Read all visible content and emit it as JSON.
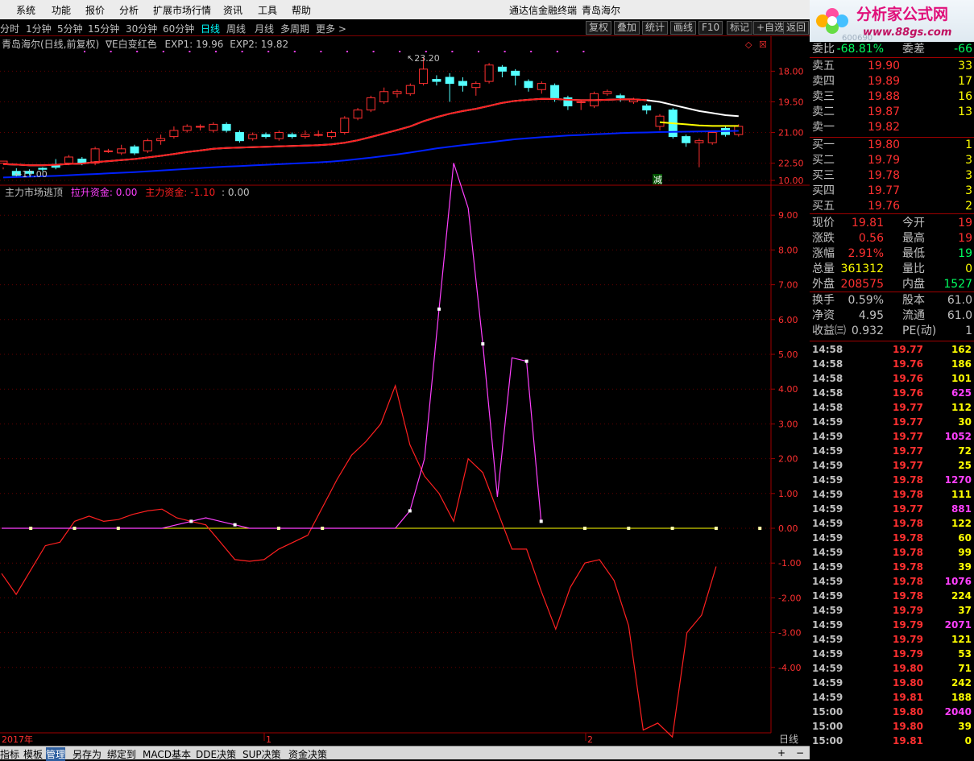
{
  "menu": [
    "系统",
    "功能",
    "报价",
    "分析",
    "扩展市场行情",
    "资讯",
    "工具",
    "帮助"
  ],
  "app_title": "通达信金融终端",
  "stock_name": "青岛海尔",
  "periods": [
    "分时",
    "1分钟",
    "5分钟",
    "15分钟",
    "30分钟",
    "60分钟",
    "日线",
    "周线",
    "月线",
    "多周期",
    "更多"
  ],
  "active_period": "日线",
  "tools": [
    "复权",
    "叠加",
    "统计",
    "画线",
    "F10",
    "标记",
    "+自选",
    "返回"
  ],
  "logo": {
    "brand": "分析家公式网",
    "url": "www.88gs.com",
    "code_hint": "600690"
  },
  "price_chart": {
    "title": "青岛海尔(日线,前复权)",
    "indicator": "∇E白变红色",
    "exp1_label": "EXP1:",
    "exp1_value": "19.96",
    "exp2_label": "EXP2:",
    "exp2_value": "19.82",
    "high_label": "23.20",
    "low_label": "17.00",
    "signal_text": "减",
    "y_ticks": [
      "22.50",
      "21.00",
      "19.50",
      "18.00"
    ]
  },
  "indicator_chart": {
    "title": "主力市场逃顶",
    "s1_label": "拉升资金:",
    "s1_value": "0.00",
    "s2_label": "主力资金:",
    "s2_value": "-1.10",
    "s3_value": ": 0.00",
    "y_ticks": [
      "10.00",
      "9.00",
      "8.00",
      "7.00",
      "6.00",
      "5.00",
      "4.00",
      "3.00",
      "2.00",
      "1.00",
      "0.00",
      "-1.00",
      "-2.00",
      "-3.00",
      "-4.00"
    ]
  },
  "x_axis": {
    "labels": [
      "2017年",
      "1",
      "2"
    ],
    "period": "日线"
  },
  "quote": {
    "wb_label": "委比",
    "wb_value": "-68.81%",
    "wc_label": "委差",
    "wc_value": "-66",
    "asks": [
      {
        "label": "卖五",
        "price": "19.90",
        "vol": "33"
      },
      {
        "label": "卖四",
        "price": "19.89",
        "vol": "17"
      },
      {
        "label": "卖三",
        "price": "19.88",
        "vol": "16"
      },
      {
        "label": "卖二",
        "price": "19.87",
        "vol": "13"
      },
      {
        "label": "卖一",
        "price": "19.82",
        "vol": ""
      }
    ],
    "bids": [
      {
        "label": "买一",
        "price": "19.80",
        "vol": "1"
      },
      {
        "label": "买二",
        "price": "19.79",
        "vol": "3"
      },
      {
        "label": "买三",
        "price": "19.78",
        "vol": "3"
      },
      {
        "label": "买四",
        "price": "19.77",
        "vol": "3"
      },
      {
        "label": "买五",
        "price": "19.76",
        "vol": "2"
      }
    ],
    "stats": [
      {
        "l1": "现价",
        "v1": "19.81",
        "l2": "今开",
        "v2": "19"
      },
      {
        "l1": "涨跌",
        "v1": "0.56",
        "l2": "最高",
        "v2": "19"
      },
      {
        "l1": "涨幅",
        "v1": "2.91%",
        "l2": "最低",
        "v2": "19"
      },
      {
        "l1": "总量",
        "v1": "361312",
        "l2": "量比",
        "v2": "0"
      },
      {
        "l1": "外盘",
        "v1": "208575",
        "l2": "内盘",
        "v2": "1527"
      }
    ],
    "stats2": [
      {
        "l1": "换手",
        "v1": "0.59%",
        "l2": "股本",
        "v2": "61.0"
      },
      {
        "l1": "净资",
        "v1": "4.95",
        "l2": "流通",
        "v2": "61.0"
      },
      {
        "l1": "收益㈢",
        "v1": "0.932",
        "l2": "PE(动)",
        "v2": "1"
      }
    ]
  },
  "ticks": [
    {
      "t": "14:58",
      "p": "19.77",
      "v": "162",
      "c": "w"
    },
    {
      "t": "14:58",
      "p": "19.76",
      "v": "186",
      "c": "w"
    },
    {
      "t": "14:58",
      "p": "19.76",
      "v": "101",
      "c": "w"
    },
    {
      "t": "14:58",
      "p": "19.76",
      "v": "625",
      "c": "m"
    },
    {
      "t": "14:58",
      "p": "19.77",
      "v": "112",
      "c": "w"
    },
    {
      "t": "14:59",
      "p": "19.77",
      "v": "30",
      "c": "w"
    },
    {
      "t": "14:59",
      "p": "19.77",
      "v": "1052",
      "c": "m"
    },
    {
      "t": "14:59",
      "p": "19.77",
      "v": "72",
      "c": "w"
    },
    {
      "t": "14:59",
      "p": "19.77",
      "v": "25",
      "c": "w"
    },
    {
      "t": "14:59",
      "p": "19.78",
      "v": "1270",
      "c": "m"
    },
    {
      "t": "14:59",
      "p": "19.78",
      "v": "111",
      "c": "w"
    },
    {
      "t": "14:59",
      "p": "19.77",
      "v": "881",
      "c": "m"
    },
    {
      "t": "14:59",
      "p": "19.78",
      "v": "122",
      "c": "w"
    },
    {
      "t": "14:59",
      "p": "19.78",
      "v": "60",
      "c": "w"
    },
    {
      "t": "14:59",
      "p": "19.78",
      "v": "99",
      "c": "w"
    },
    {
      "t": "14:59",
      "p": "19.78",
      "v": "39",
      "c": "w"
    },
    {
      "t": "14:59",
      "p": "19.78",
      "v": "1076",
      "c": "m"
    },
    {
      "t": "14:59",
      "p": "19.78",
      "v": "224",
      "c": "w"
    },
    {
      "t": "14:59",
      "p": "19.79",
      "v": "37",
      "c": "w"
    },
    {
      "t": "14:59",
      "p": "19.79",
      "v": "2071",
      "c": "m"
    },
    {
      "t": "14:59",
      "p": "19.79",
      "v": "121",
      "c": "w"
    },
    {
      "t": "14:59",
      "p": "19.79",
      "v": "53",
      "c": "w"
    },
    {
      "t": "14:59",
      "p": "19.80",
      "v": "71",
      "c": "w"
    },
    {
      "t": "14:59",
      "p": "19.80",
      "v": "242",
      "c": "w"
    },
    {
      "t": "14:59",
      "p": "19.81",
      "v": "188",
      "c": "w"
    },
    {
      "t": "15:00",
      "p": "19.80",
      "v": "2040",
      "c": "m"
    },
    {
      "t": "15:00",
      "p": "19.80",
      "v": "39",
      "c": "w"
    },
    {
      "t": "15:00",
      "p": "19.81",
      "v": "0",
      "c": "w"
    }
  ],
  "bottom_tabs": [
    "指标",
    "模板",
    "管理",
    "另存为",
    "绑定到",
    "MACD基本",
    "DDE决策",
    "SUP决策",
    "资金决策"
  ],
  "active_bottom_tab": "管理",
  "bottom_controls": [
    "+",
    "−"
  ],
  "chart_data": [
    {
      "type": "candlestick",
      "title": "",
      "ylim": [
        17.0,
        23.5
      ],
      "y_ticks": [
        18.0,
        19.5,
        21.0,
        22.5
      ],
      "candles": [
        [
          18.0,
          18.1,
          17.8,
          17.7
        ],
        [
          17.6,
          17.4,
          17.75,
          17.3
        ],
        [
          17.6,
          17.5,
          17.7,
          17.4
        ],
        [
          17.75,
          17.7,
          17.8,
          17.6
        ],
        [
          17.9,
          17.8,
          18.2,
          17.7
        ],
        [
          18.0,
          18.3,
          18.4,
          17.9
        ],
        [
          18.2,
          18.0,
          18.3,
          17.9
        ],
        [
          18.0,
          18.7,
          18.8,
          17.9
        ],
        [
          18.6,
          18.6,
          18.7,
          18.5
        ],
        [
          18.5,
          18.7,
          18.9,
          18.4
        ],
        [
          18.8,
          18.5,
          18.9,
          18.4
        ],
        [
          18.6,
          19.1,
          19.2,
          18.5
        ],
        [
          19.1,
          19.2,
          19.4,
          18.9
        ],
        [
          19.3,
          19.6,
          19.8,
          19.2
        ],
        [
          19.6,
          19.8,
          19.9,
          19.5
        ],
        [
          19.8,
          19.8,
          19.9,
          19.6
        ],
        [
          19.6,
          19.9,
          20.0,
          19.5
        ],
        [
          19.9,
          19.6,
          20.0,
          19.5
        ],
        [
          19.5,
          19.1,
          19.6,
          19.0
        ],
        [
          19.2,
          19.4,
          19.5,
          19.1
        ],
        [
          19.4,
          19.3,
          19.5,
          19.2
        ],
        [
          19.2,
          19.5,
          19.6,
          19.1
        ],
        [
          19.4,
          19.3,
          19.5,
          19.2
        ],
        [
          19.3,
          19.4,
          19.6,
          19.2
        ],
        [
          19.4,
          19.4,
          19.6,
          19.3
        ],
        [
          19.3,
          19.5,
          19.6,
          19.2
        ],
        [
          19.5,
          20.2,
          20.3,
          19.4
        ],
        [
          20.2,
          20.6,
          20.7,
          20.1
        ],
        [
          20.6,
          21.2,
          21.3,
          20.5
        ],
        [
          21.0,
          21.5,
          21.7,
          20.9
        ],
        [
          21.4,
          21.5,
          21.6,
          21.2
        ],
        [
          21.4,
          21.8,
          21.9,
          21.3
        ],
        [
          21.9,
          22.6,
          23.2,
          21.8
        ],
        [
          22.1,
          22.0,
          22.3,
          21.8
        ],
        [
          22.2,
          21.9,
          22.4,
          21.0
        ],
        [
          22.0,
          21.8,
          22.2,
          21.5
        ],
        [
          21.7,
          21.9,
          22.0,
          21.3
        ],
        [
          22.0,
          22.8,
          22.9,
          21.9
        ],
        [
          22.7,
          22.5,
          22.8,
          22.2
        ],
        [
          22.5,
          22.3,
          22.6,
          21.8
        ],
        [
          22.0,
          21.7,
          22.1,
          21.5
        ],
        [
          21.6,
          21.9,
          22.0,
          21.4
        ],
        [
          21.8,
          21.2,
          21.9,
          21.0
        ],
        [
          21.2,
          20.8,
          21.3,
          20.6
        ],
        [
          21.0,
          21.0,
          21.1,
          20.6
        ],
        [
          20.8,
          21.4,
          21.5,
          20.7
        ],
        [
          21.4,
          21.5,
          21.6,
          21.3
        ],
        [
          21.3,
          21.2,
          21.4,
          21.0
        ],
        [
          21.0,
          21.1,
          21.2,
          20.9
        ],
        [
          20.8,
          20.6,
          20.9,
          20.4
        ],
        [
          19.8,
          20.3,
          20.4,
          19.6
        ],
        [
          20.6,
          19.3,
          20.7,
          19.2
        ],
        [
          19.3,
          19.0,
          19.4,
          18.8
        ],
        [
          19.0,
          19.1,
          19.2,
          17.8
        ],
        [
          19.0,
          19.5,
          19.6,
          18.9
        ],
        [
          19.7,
          19.4,
          19.8,
          19.3
        ],
        [
          19.4,
          19.8,
          19.9,
          19.3
        ]
      ],
      "series": [
        {
          "name": "EXP1",
          "color": "#ffffff",
          "values": [
            17.95,
            17.93,
            17.9,
            17.9,
            17.92,
            17.96,
            17.98,
            18.05,
            18.1,
            18.15,
            18.2,
            18.28,
            18.36,
            18.45,
            18.55,
            18.62,
            18.7,
            18.74,
            18.76,
            18.78,
            18.8,
            18.82,
            18.84,
            18.86,
            18.88,
            18.92,
            19.0,
            19.12,
            19.28,
            19.45,
            19.62,
            19.8,
            20.05,
            20.25,
            20.42,
            20.55,
            20.66,
            20.8,
            20.95,
            21.05,
            21.1,
            21.15,
            21.14,
            21.1,
            21.08,
            21.08,
            21.1,
            21.12,
            21.12,
            21.08,
            21.0,
            20.85,
            20.7,
            20.55,
            20.45,
            20.35,
            20.3
          ]
        },
        {
          "name": "EXP2",
          "color": "#ffff00",
          "values": [
            null,
            null,
            null,
            null,
            null,
            null,
            null,
            null,
            null,
            null,
            null,
            null,
            null,
            null,
            null,
            null,
            null,
            null,
            null,
            null,
            null,
            null,
            null,
            null,
            null,
            null,
            null,
            null,
            null,
            null,
            null,
            null,
            null,
            null,
            null,
            null,
            null,
            null,
            null,
            null,
            null,
            null,
            null,
            null,
            null,
            null,
            null,
            null,
            null,
            null,
            20.0,
            19.95,
            19.9,
            19.85,
            19.82,
            19.82,
            19.82
          ]
        },
        {
          "name": "RED",
          "color": "#ff2020",
          "values": [
            17.95,
            17.93,
            17.9,
            17.9,
            17.92,
            17.96,
            17.98,
            18.05,
            18.1,
            18.15,
            18.2,
            18.28,
            18.36,
            18.45,
            18.55,
            18.62,
            18.7,
            18.74,
            18.76,
            18.78,
            18.8,
            18.82,
            18.84,
            18.86,
            18.88,
            18.92,
            19.0,
            19.12,
            19.28,
            19.45,
            19.62,
            19.8,
            20.05,
            20.25,
            20.42,
            20.55,
            20.66,
            20.8,
            20.95,
            21.05,
            21.1,
            21.15,
            21.14,
            21.1,
            21.08,
            21.08,
            21.1,
            21.12,
            21.12,
            21.08,
            null,
            null,
            null,
            null,
            null,
            null,
            null
          ]
        },
        {
          "name": "BLUE",
          "color": "#0020ff",
          "values": [
            17.3,
            17.32,
            17.34,
            17.36,
            17.38,
            17.41,
            17.44,
            17.47,
            17.5,
            17.53,
            17.56,
            17.6,
            17.64,
            17.68,
            17.72,
            17.76,
            17.8,
            17.83,
            17.86,
            17.89,
            17.92,
            17.95,
            17.98,
            18.01,
            18.04,
            18.08,
            18.13,
            18.2,
            18.27,
            18.35,
            18.43,
            18.52,
            18.62,
            18.72,
            18.8,
            18.88,
            18.95,
            19.02,
            19.1,
            19.17,
            19.22,
            19.27,
            19.31,
            19.35,
            19.38,
            19.41,
            19.44,
            19.47,
            19.49,
            19.5,
            19.52,
            19.53,
            19.54,
            19.55,
            19.56,
            19.57,
            19.58
          ]
        }
      ],
      "labels": [
        {
          "text": "23.20",
          "x": 32
        },
        {
          "text": "17.00",
          "x": 1
        }
      ]
    },
    {
      "type": "line",
      "title": "主力市场逃顶",
      "ylim": [
        -6.4,
        11.2
      ],
      "y_ticks": [
        10,
        9,
        8,
        7,
        6,
        5,
        4,
        3,
        2,
        1,
        0,
        -1,
        -2,
        -3,
        -4
      ],
      "series": [
        {
          "name": "拉升资金",
          "color": "#ff40ff",
          "values": [
            0,
            0,
            0,
            0,
            0,
            0,
            0,
            0,
            0,
            0,
            0,
            0,
            0.1,
            0.2,
            0.3,
            0.2,
            0.1,
            0,
            0,
            0,
            0,
            0,
            0,
            0,
            0,
            0,
            0,
            0,
            0.5,
            2,
            6.3,
            10.5,
            9.2,
            5.3,
            0.9,
            4.9,
            4.8,
            0.2,
            0,
            0,
            0,
            0,
            0,
            0,
            0,
            0,
            0,
            0,
            0,
            0,
            0,
            0,
            0,
            0,
            0,
            0,
            0
          ],
          "dots": [
            2,
            5,
            8,
            13,
            16,
            19,
            22,
            28,
            30,
            33,
            36,
            37,
            40,
            43,
            46,
            49,
            52
          ]
        },
        {
          "name": "主力资金",
          "color": "#ff2020",
          "values": [
            -1.3,
            -1.9,
            -1.2,
            -0.5,
            -0.4,
            0.2,
            0.35,
            0.2,
            0.25,
            0.4,
            0.5,
            0.55,
            0.3,
            0.2,
            0.1,
            -0.4,
            -0.9,
            -0.95,
            -0.9,
            -0.6,
            -0.4,
            -0.2,
            0.6,
            1.4,
            2.1,
            2.5,
            3.0,
            4.1,
            2.4,
            1.5,
            1.0,
            0.2,
            2.0,
            1.6,
            0.5,
            -0.6,
            -0.6,
            -1.8,
            -2.9,
            -1.7,
            -1.0,
            -0.9,
            -1.5,
            -2.8,
            -5.8,
            -5.6,
            -6.0,
            -3.0,
            -2.5,
            -1.1
          ]
        },
        {
          "name": "0.00",
          "color": "#ffff00",
          "values": [
            0,
            0,
            0,
            0,
            0,
            0,
            0,
            0,
            0,
            0,
            0,
            0,
            0,
            0,
            0,
            0,
            0,
            0,
            0,
            0,
            0,
            0,
            0,
            0,
            0,
            0,
            0,
            0,
            0,
            0,
            0,
            0,
            0,
            0,
            0,
            0,
            0,
            0,
            0,
            0,
            0,
            0,
            0,
            0,
            0,
            0,
            0,
            0,
            0,
            0,
            0,
            0,
            0,
            0,
            0,
            0,
            0
          ]
        }
      ]
    }
  ]
}
